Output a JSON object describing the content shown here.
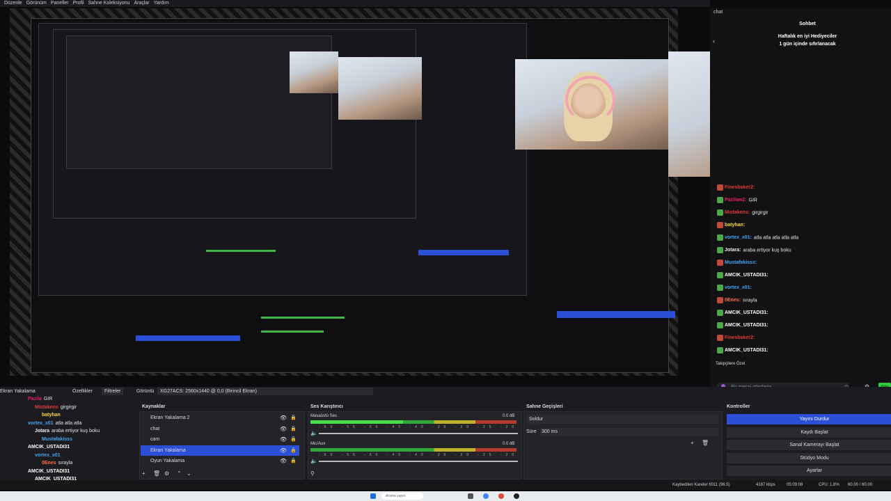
{
  "menu": [
    "Düzenle",
    "Görünüm",
    "Paneller",
    "Profil",
    "Sahne Koleksiyonu",
    "Araçlar",
    "Yardım"
  ],
  "chat": {
    "panel_label": "chat",
    "title": "Sohbet",
    "leaderboard_line1": "Haftalık en iyi Hediyeciler",
    "leaderboard_line2": "1 gün içinde sıfırlanacak",
    "messages": [
      {
        "user": "Finesbaker2:",
        "text": "",
        "color": "#e53935"
      },
      {
        "user": "Pazilaw2:",
        "text": "GIR",
        "color": "#e91e63"
      },
      {
        "user": "Mistakens:",
        "text": "girgirgir",
        "color": "#e53935"
      },
      {
        "user": "batyhan:",
        "text": "",
        "color": "#fdd835"
      },
      {
        "user": "vortex_x01:",
        "text": "atla atla atla atla atla",
        "color": "#42a5f5"
      },
      {
        "user": "Jotara:",
        "text": "araba ertiyor kuş boku",
        "color": "#eeeeee"
      },
      {
        "user": "Mustafakisss:",
        "text": "",
        "color": "#42a5f5"
      },
      {
        "user": "AMCIK_USTADI31:",
        "text": "",
        "color": "#ffffff"
      },
      {
        "user": "vortex_x01:",
        "text": "",
        "color": "#42a5f5"
      },
      {
        "user": "0Enes:",
        "text": "sırayla",
        "color": "#ff7043"
      },
      {
        "user": "AMCIK_USTADI31:",
        "text": "",
        "color": "#ffffff"
      },
      {
        "user": "AMCIK_USTADI31:",
        "text": "",
        "color": "#ffffff"
      },
      {
        "user": "Finesbaker2:",
        "text": "",
        "color": "#e53935"
      },
      {
        "user": "AMCIK_USTADI31:",
        "text": "",
        "color": "#ffffff"
      }
    ],
    "followers_only": "Takipçilere Özel",
    "input_placeholder": "Bir mesaj gönderin",
    "send_label": "Gön"
  },
  "toolbar": {
    "source_name": "Ekran Yakalama",
    "properties": "Özellikler",
    "filters": "Filtreler",
    "display_label": "Görüntü",
    "display_value": "XG27ACS: 2560x1440 @ 0,0 (Birincil Ekran)"
  },
  "sources": {
    "header": "Kaynaklar",
    "items": [
      {
        "label": "Ekran Yakalama 2"
      },
      {
        "label": "chat"
      },
      {
        "label": "cam"
      },
      {
        "label": "Ekran Yakalama",
        "selected": true
      },
      {
        "label": "Oyun Yakalama"
      }
    ]
  },
  "mixer": {
    "header": "Ses Karıştırıcı",
    "tracks": [
      {
        "name": "Masaüstü Ses",
        "db": "0.0 dB",
        "level": 0.45
      },
      {
        "name": "Mic/Aux",
        "db": "0.0 dB",
        "level": 0.0
      }
    ],
    "ticks": "-60 -55 -50 -45 -40 -35 -30 -25 -20 -15 -10 -5 0"
  },
  "transitions": {
    "header": "Sahne Geçişleri",
    "selected": "Soldur",
    "duration_label": "Süre",
    "duration_value": "300 ms"
  },
  "controls": {
    "header": "Kontroller",
    "buttons": [
      "Yayını Durdur",
      "Kaydı Başlat",
      "Sanal Kamerayı Başlat",
      "Stüdyo Modu",
      "Ayarlar"
    ]
  },
  "left_chat": [
    {
      "user": "Pazila",
      "text": "GIR",
      "color": "#e91e63"
    },
    {
      "user": "Mistakens",
      "text": "girgirgir",
      "color": "#e53935"
    },
    {
      "user": "batyhan",
      "text": "",
      "color": "#fdd835"
    },
    {
      "user": "vortex_x01",
      "text": "atla atla atla",
      "color": "#42a5f5"
    },
    {
      "user": "Jotara",
      "text": "araba ertiyor kuş boku",
      "color": "#eeeeee"
    },
    {
      "user": "Mustafakisss",
      "text": "",
      "color": "#42a5f5"
    },
    {
      "user": "AMCIK_USTADI31",
      "text": "",
      "color": "#ffffff"
    },
    {
      "user": "vortex_x01",
      "text": "",
      "color": "#42a5f5"
    },
    {
      "user": "0Enes",
      "text": "sırayla",
      "color": "#ff7043"
    },
    {
      "user": "AMCIK_USTADI31",
      "text": "",
      "color": "#ffffff"
    },
    {
      "user": "AMCIK_USTADI31",
      "text": "",
      "color": "#ffffff"
    }
  ],
  "status": {
    "dropped": "Kaybedilen Kareler 6011 (96.5)",
    "bitrate": "4187 kbps",
    "time": "05:09:08",
    "cpu": "CPU: 1.8%",
    "fps": "60.00 / 60.00"
  },
  "taskbar": {
    "search_placeholder": "Arama yapın"
  }
}
